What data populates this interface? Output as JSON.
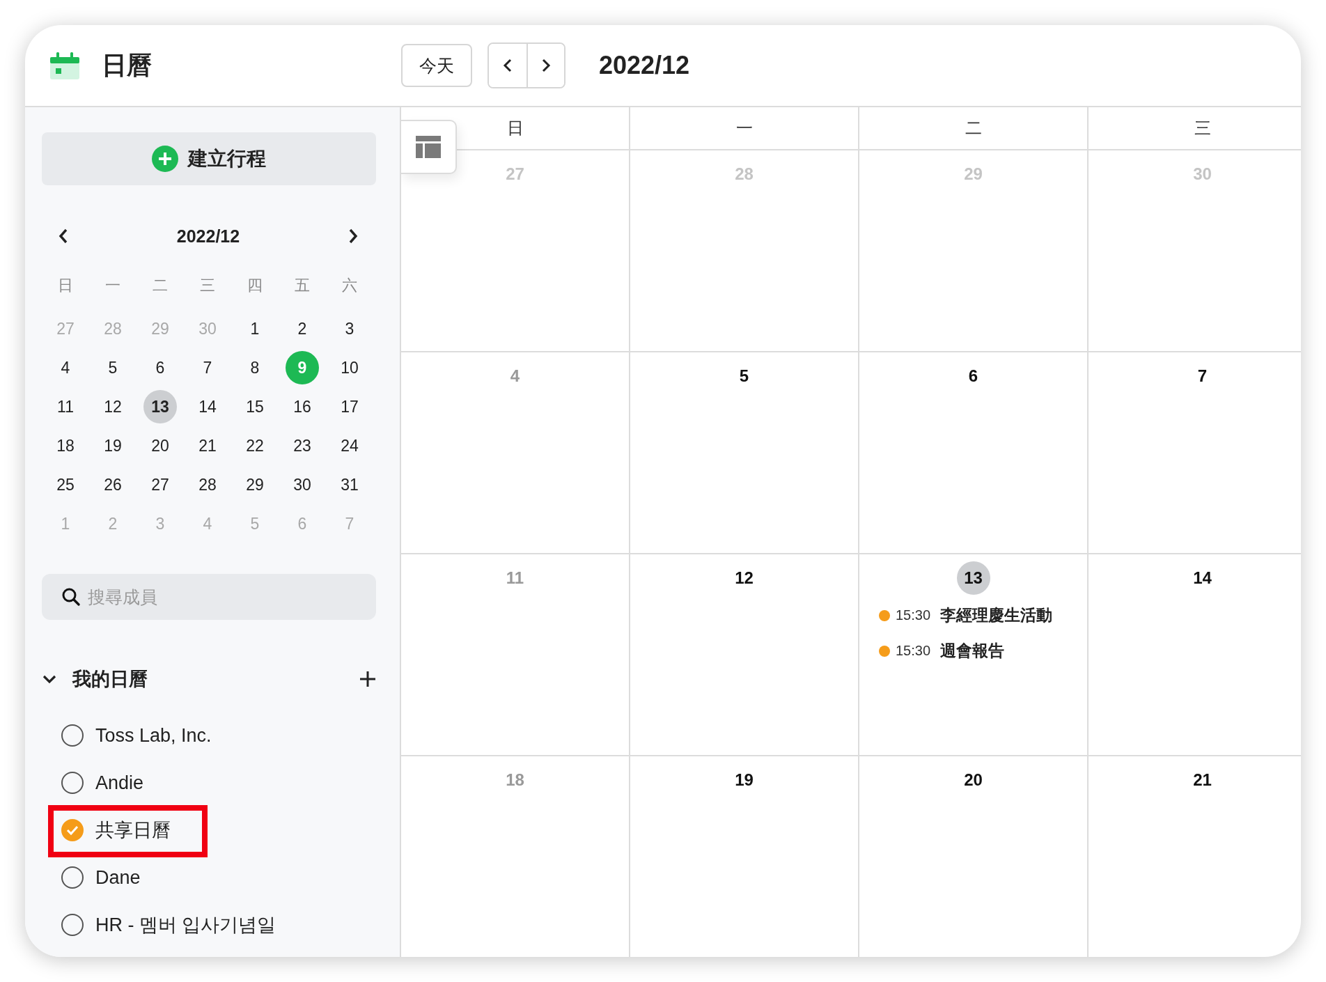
{
  "app": {
    "title": "日曆"
  },
  "toolbar": {
    "today_button": "今天",
    "month": "2022/12"
  },
  "sidebar": {
    "create_button": "建立行程",
    "mini_calendar": {
      "month": "2022/12",
      "weekdays": [
        "日",
        "一",
        "二",
        "三",
        "四",
        "五",
        "六"
      ],
      "days": [
        {
          "label": "27",
          "kind": "other",
          "selected": false,
          "today": false
        },
        {
          "label": "28",
          "kind": "other",
          "selected": false,
          "today": false
        },
        {
          "label": "29",
          "kind": "other",
          "selected": false,
          "today": false
        },
        {
          "label": "30",
          "kind": "other",
          "selected": false,
          "today": false
        },
        {
          "label": "1",
          "kind": "day",
          "selected": false,
          "today": false
        },
        {
          "label": "2",
          "kind": "day",
          "selected": false,
          "today": false
        },
        {
          "label": "3",
          "kind": "day",
          "selected": false,
          "today": false
        },
        {
          "label": "4",
          "kind": "day",
          "selected": false,
          "today": false
        },
        {
          "label": "5",
          "kind": "day",
          "selected": false,
          "today": false
        },
        {
          "label": "6",
          "kind": "day",
          "selected": false,
          "today": false
        },
        {
          "label": "7",
          "kind": "day",
          "selected": false,
          "today": false
        },
        {
          "label": "8",
          "kind": "day",
          "selected": false,
          "today": false
        },
        {
          "label": "9",
          "kind": "day",
          "selected": true,
          "today": false
        },
        {
          "label": "10",
          "kind": "day",
          "selected": false,
          "today": false
        },
        {
          "label": "11",
          "kind": "day",
          "selected": false,
          "today": false
        },
        {
          "label": "12",
          "kind": "day",
          "selected": false,
          "today": false
        },
        {
          "label": "13",
          "kind": "day",
          "selected": false,
          "today": true
        },
        {
          "label": "14",
          "kind": "day",
          "selected": false,
          "today": false
        },
        {
          "label": "15",
          "kind": "day",
          "selected": false,
          "today": false
        },
        {
          "label": "16",
          "kind": "day",
          "selected": false,
          "today": false
        },
        {
          "label": "17",
          "kind": "day",
          "selected": false,
          "today": false
        },
        {
          "label": "18",
          "kind": "day",
          "selected": false,
          "today": false
        },
        {
          "label": "19",
          "kind": "day",
          "selected": false,
          "today": false
        },
        {
          "label": "20",
          "kind": "day",
          "selected": false,
          "today": false
        },
        {
          "label": "21",
          "kind": "day",
          "selected": false,
          "today": false
        },
        {
          "label": "22",
          "kind": "day",
          "selected": false,
          "today": false
        },
        {
          "label": "23",
          "kind": "day",
          "selected": false,
          "today": false
        },
        {
          "label": "24",
          "kind": "day",
          "selected": false,
          "today": false
        },
        {
          "label": "25",
          "kind": "day",
          "selected": false,
          "today": false
        },
        {
          "label": "26",
          "kind": "day",
          "selected": false,
          "today": false
        },
        {
          "label": "27",
          "kind": "day",
          "selected": false,
          "today": false
        },
        {
          "label": "28",
          "kind": "day",
          "selected": false,
          "today": false
        },
        {
          "label": "29",
          "kind": "day",
          "selected": false,
          "today": false
        },
        {
          "label": "30",
          "kind": "day",
          "selected": false,
          "today": false
        },
        {
          "label": "31",
          "kind": "day",
          "selected": false,
          "today": false
        },
        {
          "label": "1",
          "kind": "other",
          "selected": false,
          "today": false
        },
        {
          "label": "2",
          "kind": "other",
          "selected": false,
          "today": false
        },
        {
          "label": "3",
          "kind": "other",
          "selected": false,
          "today": false
        },
        {
          "label": "4",
          "kind": "other",
          "selected": false,
          "today": false
        },
        {
          "label": "5",
          "kind": "other",
          "selected": false,
          "today": false
        },
        {
          "label": "6",
          "kind": "other",
          "selected": false,
          "today": false
        },
        {
          "label": "7",
          "kind": "other",
          "selected": false,
          "today": false
        }
      ]
    },
    "search": {
      "placeholder": "搜尋成員"
    },
    "my_calendars": {
      "title": "我的日曆",
      "expanded": true,
      "items": [
        {
          "name": "Toss Lab, Inc.",
          "checked": false,
          "highlighted": false
        },
        {
          "name": "Andie",
          "checked": false,
          "highlighted": false
        },
        {
          "name": "共享日曆",
          "checked": true,
          "highlighted": true
        },
        {
          "name": "Dane",
          "checked": false,
          "highlighted": false
        },
        {
          "name": "HR - 멤버 입사기념일",
          "checked": false,
          "highlighted": false
        }
      ]
    }
  },
  "calendar": {
    "weekdays": [
      "日",
      "一",
      "二",
      "三"
    ],
    "weeks": [
      {
        "days": [
          {
            "label": "27",
            "kind": "other",
            "today": false
          },
          {
            "label": "28",
            "kind": "other",
            "today": false
          },
          {
            "label": "29",
            "kind": "other",
            "today": false
          },
          {
            "label": "30",
            "kind": "other",
            "today": false
          }
        ]
      },
      {
        "days": [
          {
            "label": "4",
            "kind": "sunday",
            "today": false
          },
          {
            "label": "5",
            "kind": "day",
            "today": false
          },
          {
            "label": "6",
            "kind": "day",
            "today": false
          },
          {
            "label": "7",
            "kind": "day",
            "today": false
          }
        ]
      },
      {
        "days": [
          {
            "label": "11",
            "kind": "sunday",
            "today": false
          },
          {
            "label": "12",
            "kind": "day",
            "today": false
          },
          {
            "label": "13",
            "kind": "day",
            "today": true,
            "events": [
              {
                "time": "15:30",
                "title": "李經理慶生活動",
                "color": "#f59c1a"
              },
              {
                "time": "15:30",
                "title": "週會報告",
                "color": "#f59c1a"
              }
            ]
          },
          {
            "label": "14",
            "kind": "day",
            "today": false
          }
        ]
      },
      {
        "days": [
          {
            "label": "18",
            "kind": "sunday",
            "today": false
          },
          {
            "label": "19",
            "kind": "day",
            "today": false
          },
          {
            "label": "20",
            "kind": "day",
            "today": false
          },
          {
            "label": "21",
            "kind": "day",
            "today": false
          }
        ]
      }
    ]
  }
}
